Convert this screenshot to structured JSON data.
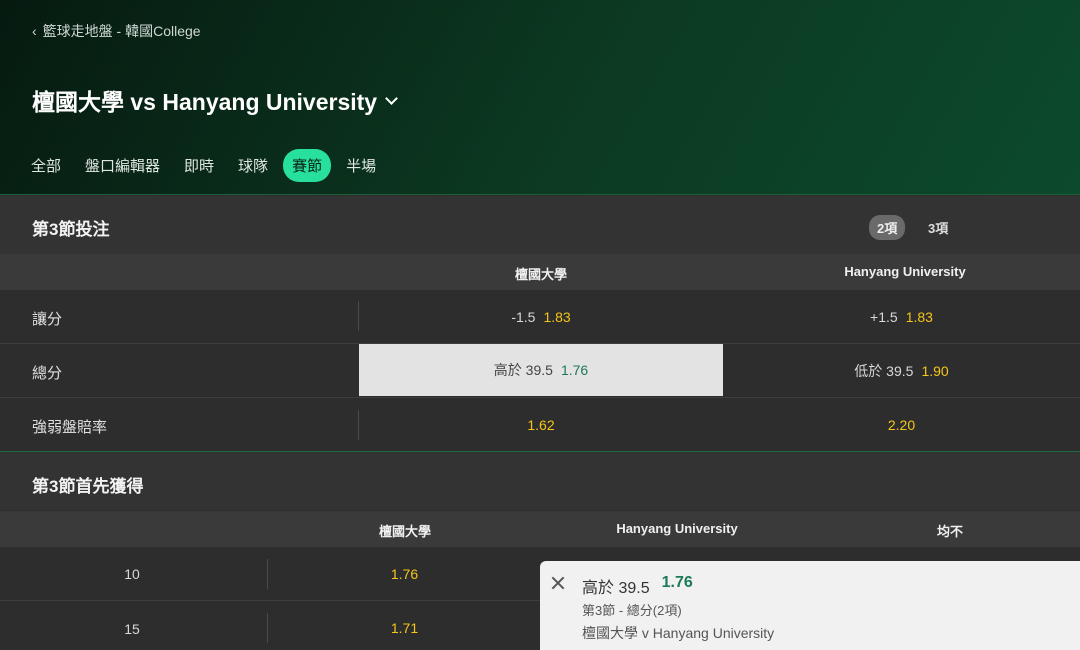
{
  "header": {
    "breadcrumb": "籃球走地盤 - 韓國College",
    "title": "檀國大學 vs Hanyang University",
    "tabs": [
      "全部",
      "盤口編輯器",
      "即時",
      "球隊",
      "賽節",
      "半場"
    ],
    "active_tab": "賽節"
  },
  "section1": {
    "title": "第3節投注",
    "toggle": [
      "2項",
      "3項"
    ],
    "active_toggle": "2項",
    "columns": [
      "檀國大學",
      "Hanyang University"
    ],
    "rows": [
      {
        "label": "讓分",
        "home_line": "-1.5",
        "home_odds": "1.83",
        "away_line": "+1.5",
        "away_odds": "1.83"
      },
      {
        "label": "總分",
        "home_line": "高於 39.5",
        "home_odds": "1.76",
        "away_line": "低於 39.5",
        "away_odds": "1.90"
      },
      {
        "label": "強弱盤賠率",
        "home_odds": "1.62",
        "away_odds": "2.20"
      }
    ]
  },
  "section2": {
    "title": "第3節首先獲得",
    "columns": [
      "檀國大學",
      "Hanyang University",
      "均不"
    ],
    "rows": [
      {
        "points": "10",
        "home_odds": "1.76"
      },
      {
        "points": "15",
        "home_odds": "1.71"
      }
    ]
  },
  "betslip": {
    "selection": "高於 39.5",
    "odds": "1.76",
    "market": "第3節 - 總分(2項)",
    "event": "檀國大學 v Hanyang University"
  },
  "colors": {
    "accent": "#27e09e",
    "odds": "#f5c518",
    "selected_odds": "#1c7a55"
  }
}
